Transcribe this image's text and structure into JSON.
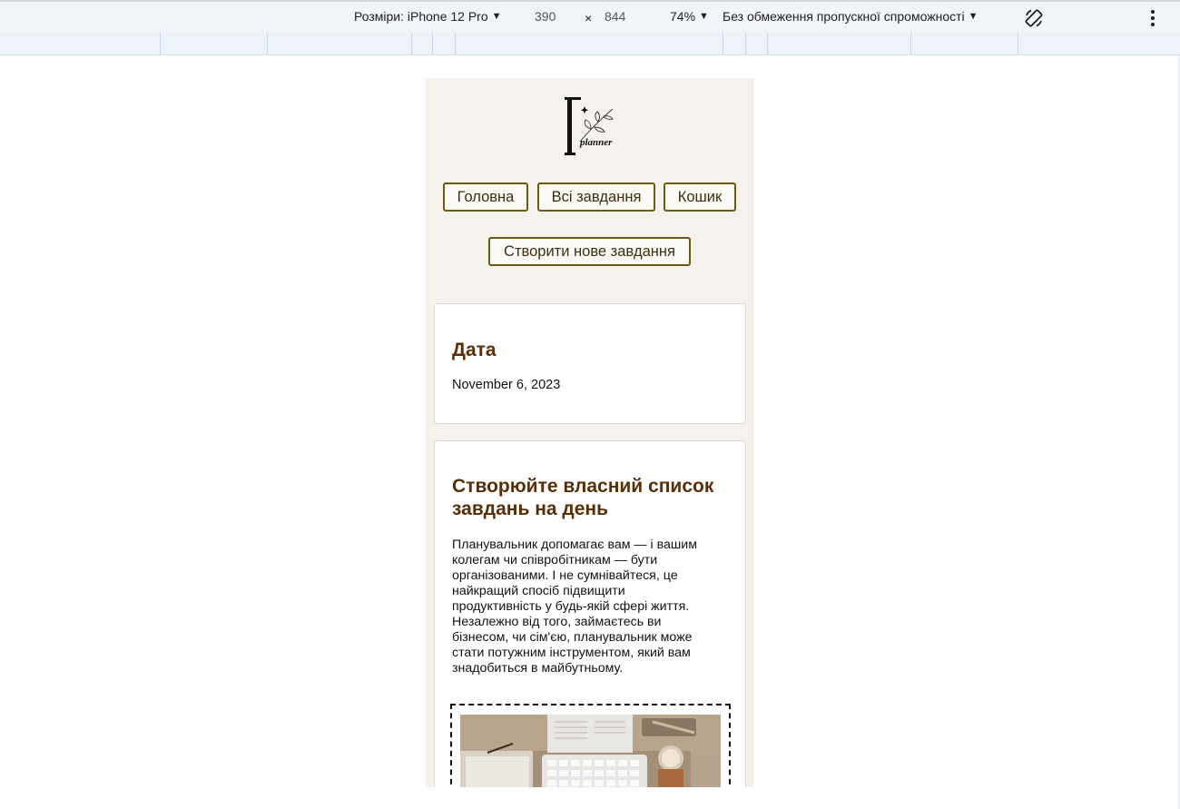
{
  "devtools": {
    "dimensions_label": "Розміри: iPhone 12 Pro",
    "width_value": "390",
    "times": "×",
    "height_value": "844",
    "zoom": "74%",
    "throttling": "Без обмеження пропускної спроможності",
    "icons": [
      "chevron-down-icon",
      "rotate-icon",
      "more-vert-icon"
    ]
  },
  "site": {
    "logo_text": "planner",
    "nav": {
      "home": "Головна",
      "all_tasks": "Всі завдання",
      "cart": "Кошик",
      "create": "Створити нове завдання"
    },
    "date_card": {
      "title": "Дата",
      "value": "November 6, 2023"
    },
    "intro_card": {
      "title": "Створюйте власний список завдань на день",
      "body": "Планувальник допомагає вам — і вашим колегам чи співробітникам — бути організованими. І не сумнівайтеся, це найкращий спосіб підвищити продуктивність у будь-якій сфері життя. Незалежно від того, займаєтесь ви бізнесом, чи сім'єю, планувальник може стати потужним інструментом, який вам знадобиться в майбутньому."
    }
  },
  "colors": {
    "page_bg": "#f5f2ed",
    "button_border": "#6b5a14",
    "heading": "#5a2e06"
  }
}
